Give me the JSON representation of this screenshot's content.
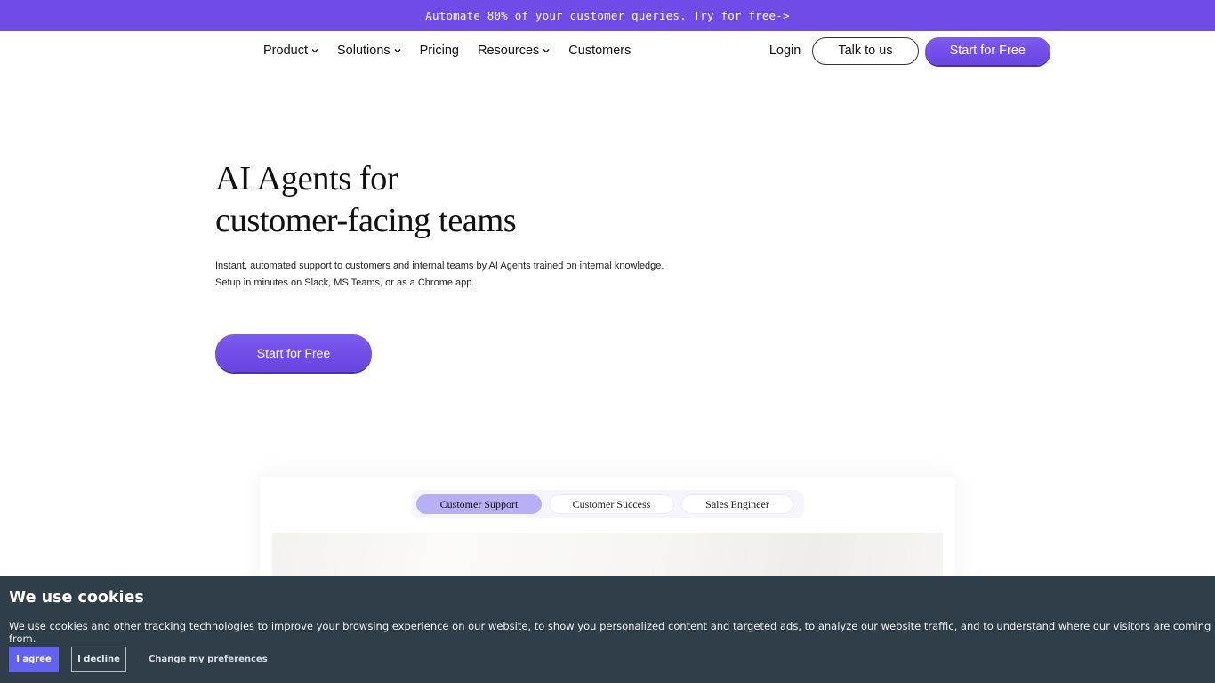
{
  "announcement": {
    "text": "Automate 80% of your customer queries. Try for free->",
    "background_color": "#6f4ce6"
  },
  "nav": {
    "items": [
      {
        "label": "Product",
        "has_dropdown": true
      },
      {
        "label": "Solutions",
        "has_dropdown": true
      },
      {
        "label": "Pricing",
        "has_dropdown": false
      },
      {
        "label": "Resources",
        "has_dropdown": true
      },
      {
        "label": "Customers",
        "has_dropdown": false
      }
    ],
    "login_label": "Login",
    "talk_label": "Talk to us",
    "start_label": "Start for Free"
  },
  "hero": {
    "title_line1": "AI Agents for",
    "title_line2": "customer-facing teams",
    "subtitle": "Instant, automated support to customers and internal teams by AI Agents trained on internal knowledge. Setup in minutes on Slack, MS Teams, or as a Chrome app.",
    "cta_label": "Start for Free"
  },
  "product_tabs": {
    "tabs": [
      {
        "label": "Customer Support",
        "active": true
      },
      {
        "label": "Customer Success",
        "active": false
      },
      {
        "label": "Sales Engineer",
        "active": false
      }
    ],
    "active_color": "#b7b0f6"
  },
  "cookie_banner": {
    "title": "We use cookies",
    "text": "We use cookies and other tracking technologies to improve your browsing experience on our website, to show you personalized content and targeted ads, to analyze our website traffic, and to understand where our visitors are coming from.",
    "agree_label": "I agree",
    "decline_label": "I decline",
    "preferences_label": "Change my preferences",
    "background_color": "#2f3e48",
    "agree_color": "#6262ef"
  },
  "colors": {
    "brand_purple": "#6f4ce6"
  }
}
